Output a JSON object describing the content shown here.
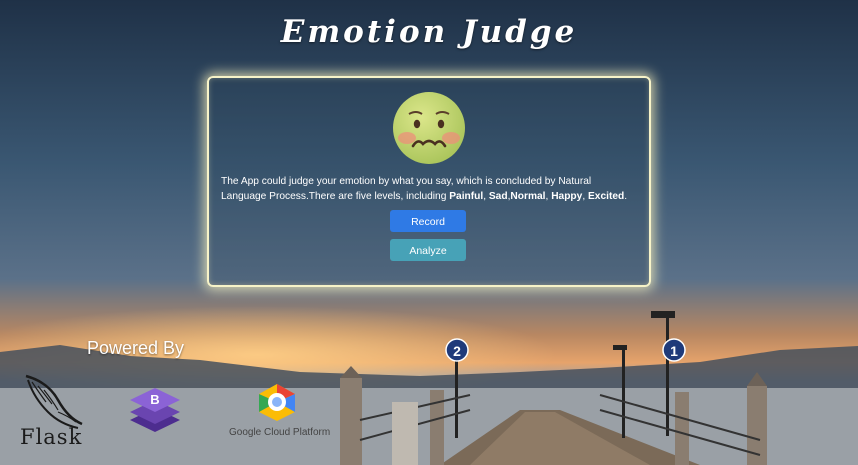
{
  "header": {
    "title": "Emotion Judge"
  },
  "main": {
    "emoji_icon": "nauseated-face-icon",
    "description_prefix": "The App could judge your emotion by what you say, which is concluded by Natural Language Process.There are five levels, including ",
    "levels": [
      "Painful",
      "Sad",
      "Normal",
      "Happy",
      "Excited"
    ],
    "record_label": "Record",
    "analyze_label": "Analyze"
  },
  "footer": {
    "powered_by": "Powered By",
    "flask_label": "Flask",
    "gcp_label": "Google Cloud Platform"
  },
  "colors": {
    "record_button": "#2f7ae5",
    "analyze_button": "#47a2b7",
    "panel_border": "#f7f3c8"
  }
}
